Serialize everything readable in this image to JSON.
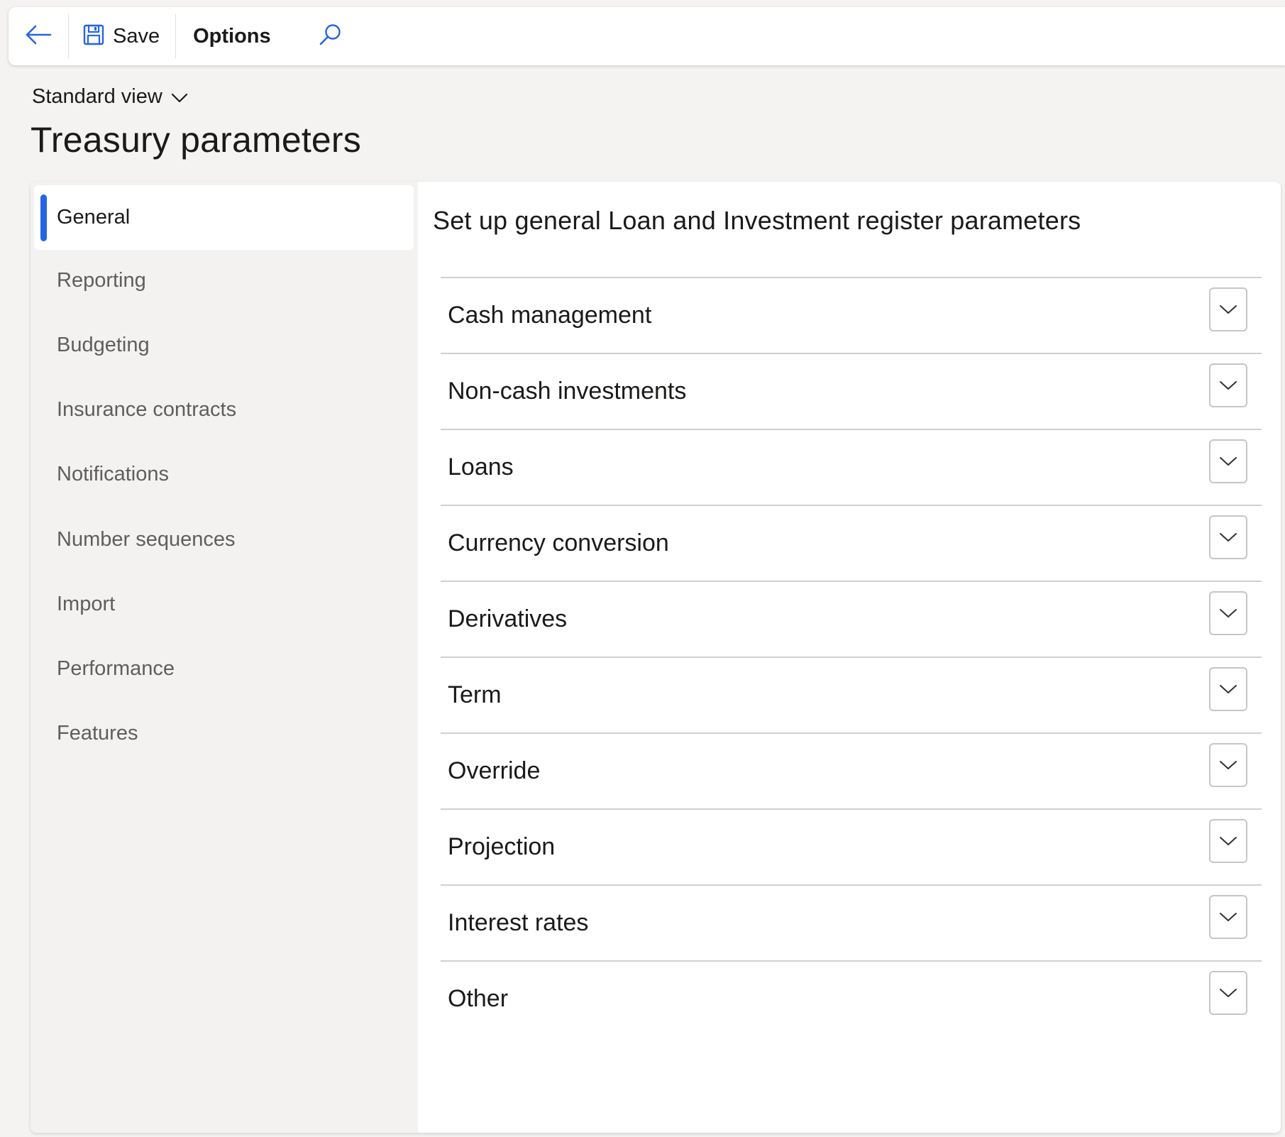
{
  "toolbar": {
    "back_icon": "arrow-left-icon",
    "save_icon": "floppy-disk-icon",
    "save_label": "Save",
    "options_label": "Options",
    "search_icon": "search-icon",
    "accent_color": "#2764e3"
  },
  "header": {
    "view_label": "Standard view",
    "view_icon": "chevron-down-icon",
    "title": "Treasury parameters"
  },
  "sidebar": {
    "items": [
      {
        "label": "General",
        "active": true
      },
      {
        "label": "Reporting",
        "active": false
      },
      {
        "label": "Budgeting",
        "active": false
      },
      {
        "label": "Insurance contracts",
        "active": false
      },
      {
        "label": "Notifications",
        "active": false
      },
      {
        "label": "Number sequences",
        "active": false
      },
      {
        "label": "Import",
        "active": false
      },
      {
        "label": "Performance",
        "active": false
      },
      {
        "label": "Features",
        "active": false
      }
    ]
  },
  "main": {
    "section_title": "Set up general Loan and Investment register parameters",
    "fasttabs": [
      {
        "label": "Cash management",
        "expanded": false
      },
      {
        "label": "Non-cash investments",
        "expanded": false
      },
      {
        "label": "Loans",
        "expanded": false
      },
      {
        "label": "Currency conversion",
        "expanded": false
      },
      {
        "label": "Derivatives",
        "expanded": false
      },
      {
        "label": "Term",
        "expanded": false
      },
      {
        "label": "Override",
        "expanded": false
      },
      {
        "label": "Projection",
        "expanded": false
      },
      {
        "label": "Interest rates",
        "expanded": false
      },
      {
        "label": "Other",
        "expanded": false
      }
    ]
  }
}
